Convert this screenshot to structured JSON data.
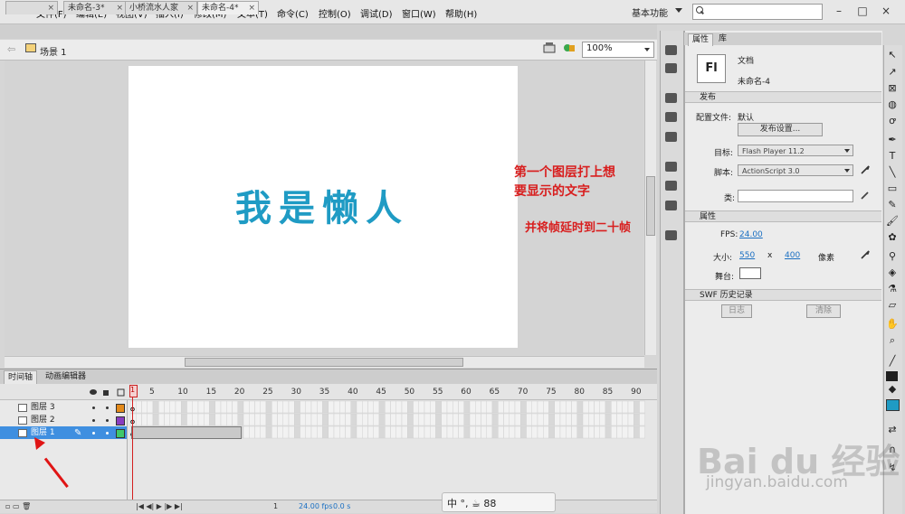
{
  "app": {
    "logo": "Fl"
  },
  "menu": [
    "文件(F)",
    "编辑(E)",
    "视图(V)",
    "插入(I)",
    "修改(M)",
    "文本(T)",
    "命令(C)",
    "控制(O)",
    "调试(D)",
    "窗口(W)",
    "帮助(H)"
  ],
  "workspace": "基本功能",
  "window_controls": [
    "–",
    "□",
    "×"
  ],
  "doc_tabs": [
    {
      "label": "",
      "active": false
    },
    {
      "label": "未命名-3*",
      "active": false
    },
    {
      "label": "小桥流水人家",
      "active": false
    },
    {
      "label": "未命名-4*",
      "active": true
    }
  ],
  "scene": {
    "label": "场景 1",
    "zoom": "100%"
  },
  "stage": {
    "text": "我是懒人",
    "text_color": "#1f9bc4"
  },
  "notes": {
    "line1": "第一个图层打上想",
    "line2": "要显示的文字",
    "line3": "并将帧延时到二十帧"
  },
  "timeline": {
    "tabs": [
      "时间轴",
      "动画编辑器"
    ],
    "ruler": [
      "5",
      "10",
      "15",
      "20",
      "25",
      "30",
      "35",
      "40",
      "45",
      "50",
      "55",
      "60",
      "65",
      "70",
      "75",
      "80",
      "85",
      "90"
    ],
    "current_frame_label": "1",
    "layers": [
      {
        "name": "图层 3",
        "color": "#e48a1a",
        "selected": false
      },
      {
        "name": "图层 2",
        "color": "#8a3cc0",
        "selected": false
      },
      {
        "name": "图层 1",
        "color": "#3ec86a",
        "selected": true
      }
    ],
    "footer": {
      "frame": "1",
      "fps": "24.00 fps",
      "time": "0.0 s"
    }
  },
  "properties": {
    "tabs": [
      "属性",
      "库"
    ],
    "doc_type": "文档",
    "doc_name": "未命名-4",
    "publish_header": "发布",
    "config_label": "配置文件:",
    "config_value": "默认",
    "publish_settings_btn": "发布设置...",
    "target_label": "目标:",
    "target_value": "Flash Player 11.2",
    "script_label": "脚本:",
    "script_value": "ActionScript 3.0",
    "class_label": "类:",
    "properties_header": "属性",
    "fps_label": "FPS:",
    "fps_value": "24.00",
    "size_label": "大小:",
    "width_value": "550",
    "x_label": "x",
    "height_value": "400",
    "unit_label": "像素",
    "stage_label": "舞台:",
    "swf_header": "SWF 历史记录",
    "log_btn": "日志",
    "clear_btn": "清除"
  },
  "ime": {
    "text": "中 °, ☕ 88"
  },
  "watermark": {
    "brand": "Bai du 经验",
    "url": "jingyan.baidu.com"
  }
}
